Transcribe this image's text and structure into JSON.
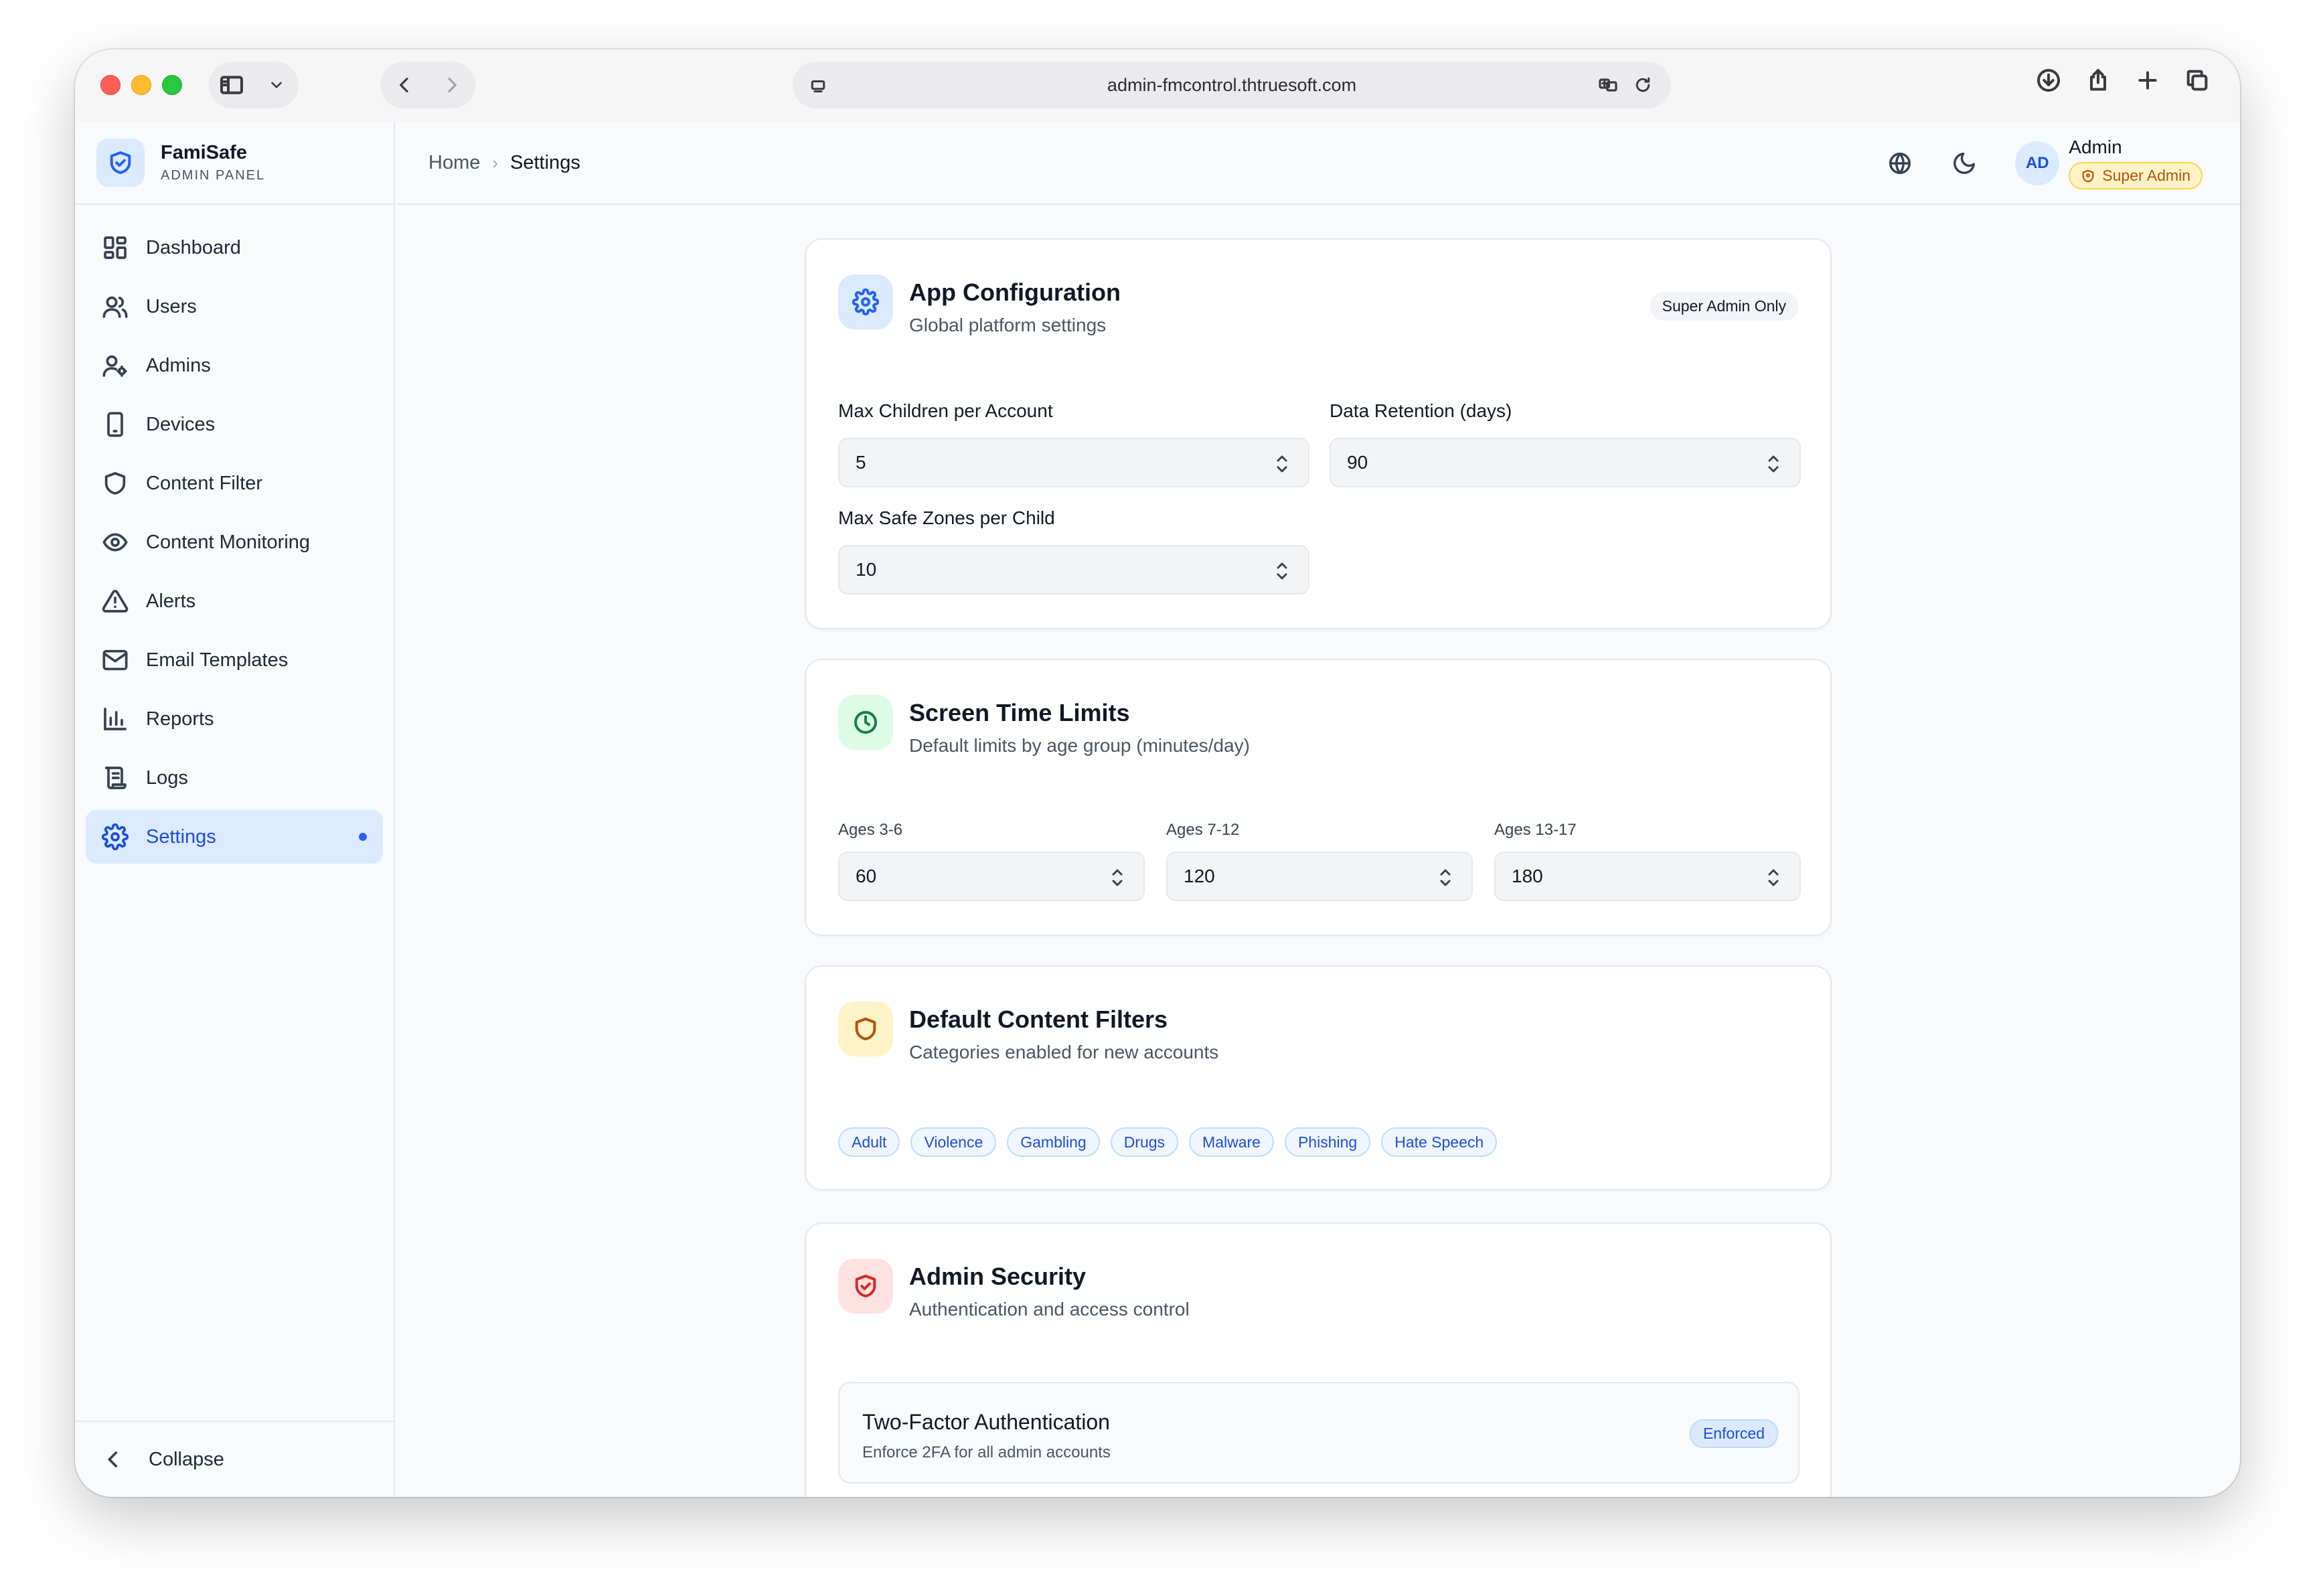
{
  "browser": {
    "url": "admin-fmcontrol.thtruesoft.com"
  },
  "brand": {
    "name": "FamiSafe",
    "subtitle": "ADMIN PANEL"
  },
  "sidebar": {
    "items": [
      {
        "label": "Dashboard",
        "icon": "dashboard-icon"
      },
      {
        "label": "Users",
        "icon": "users-icon"
      },
      {
        "label": "Admins",
        "icon": "admins-icon"
      },
      {
        "label": "Devices",
        "icon": "device-icon"
      },
      {
        "label": "Content Filter",
        "icon": "shield-icon"
      },
      {
        "label": "Content Monitoring",
        "icon": "eye-icon"
      },
      {
        "label": "Alerts",
        "icon": "warning-icon"
      },
      {
        "label": "Email Templates",
        "icon": "mail-icon"
      },
      {
        "label": "Reports",
        "icon": "bar-chart-icon"
      },
      {
        "label": "Logs",
        "icon": "scroll-icon"
      },
      {
        "label": "Settings",
        "icon": "gear-icon",
        "active": true
      }
    ],
    "collapse_label": "Collapse"
  },
  "header": {
    "breadcrumb": {
      "home": "Home",
      "current": "Settings"
    },
    "user": {
      "initials": "AD",
      "name": "Admin",
      "role": "Super Admin"
    }
  },
  "app_config": {
    "title": "App Configuration",
    "subtitle": "Global platform settings",
    "badge": "Super Admin Only",
    "max_children_label": "Max Children per Account",
    "max_children_value": "5",
    "data_retention_label": "Data Retention (days)",
    "data_retention_value": "90",
    "max_safe_zones_label": "Max Safe Zones per Child",
    "max_safe_zones_value": "10"
  },
  "screen_time": {
    "title": "Screen Time Limits",
    "subtitle": "Default limits by age group (minutes/day)",
    "groups": [
      {
        "label": "Ages 3-6",
        "value": "60"
      },
      {
        "label": "Ages 7-12",
        "value": "120"
      },
      {
        "label": "Ages 13-17",
        "value": "180"
      }
    ]
  },
  "content_filters": {
    "title": "Default Content Filters",
    "subtitle": "Categories enabled for new accounts",
    "categories": [
      "Adult",
      "Violence",
      "Gambling",
      "Drugs",
      "Malware",
      "Phishing",
      "Hate Speech"
    ]
  },
  "admin_security": {
    "title": "Admin Security",
    "subtitle": "Authentication and access control",
    "two_factor": {
      "title": "Two-Factor Authentication",
      "description": "Enforce 2FA for all admin accounts",
      "status": "Enforced"
    }
  },
  "colors": {
    "accent": "#2563eb",
    "success": "#15803d",
    "warning": "#b45309",
    "danger": "#dc2626"
  }
}
